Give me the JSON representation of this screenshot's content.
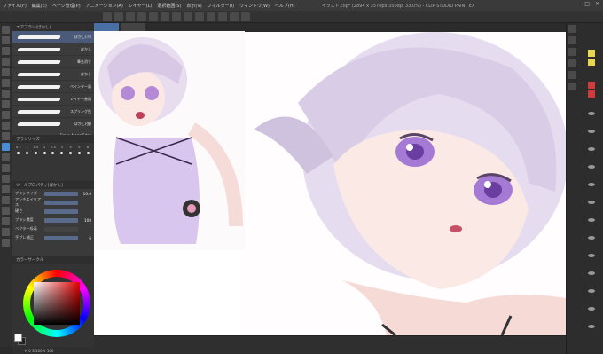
{
  "app": {
    "title_bar": "イラスト.clip* (2894 x 3570px 350dpi 33.0%) - CLIP STUDIO PAINT EX"
  },
  "menu": {
    "items": [
      "ファイル(F)",
      "編集(E)",
      "ページ管理(P)",
      "アニメーション(A)",
      "レイヤー(L)",
      "選択範囲(S)",
      "表示(V)",
      "フィルター(I)",
      "ウィンドウ(W)",
      "ヘルプ(H)"
    ]
  },
  "brush_panel": {
    "tab_label": "エアブラシ(ぼかし)",
    "brushes": [
      {
        "label": "ぼかし(少)",
        "selected": true
      },
      {
        "label": "ぼかし"
      },
      {
        "label": "筆先消す"
      },
      {
        "label": "ぼかし"
      },
      {
        "label": "ペインター風"
      },
      {
        "label": "レイヤー普通"
      },
      {
        "label": "スプリング色"
      },
      {
        "label": "ぼかし(強)"
      },
      {
        "label": "Erase Along Edge"
      }
    ]
  },
  "brush_size_panel": {
    "tab_label": "ブラシサイズ",
    "sizes": [
      "0.7",
      "1",
      "1.5",
      "2",
      "2.5",
      "3",
      "4",
      "5",
      "6"
    ]
  },
  "tool_property": {
    "tab_label": "ツールプロパティ[ぼかし]",
    "rows": [
      {
        "label": "ブラシサイズ",
        "value": "10.0"
      },
      {
        "label": "アンチエイリアス",
        "value": ""
      },
      {
        "label": "硬さ",
        "value": ""
      },
      {
        "label": "ブラシ濃度",
        "value": "100"
      },
      {
        "label": "ベクター吸着",
        "value": ""
      },
      {
        "label": "手ブレ補正",
        "value": "6"
      }
    ]
  },
  "color_panel": {
    "tab_label": "カラーサークル",
    "status_text": "H 0  S 100  V 100"
  },
  "colors": {
    "accent": "#4a8fd6",
    "selected_brush": "#4a5a78",
    "layer_yellow": "#e8d84a",
    "layer_red": "#d43a3a"
  }
}
